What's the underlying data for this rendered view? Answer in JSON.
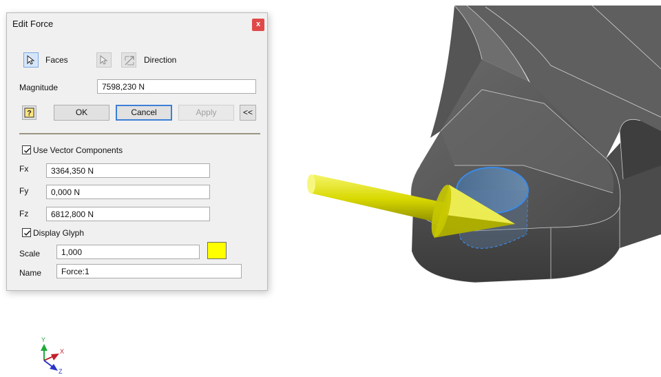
{
  "dialog": {
    "title": "Edit Force",
    "close_label": "x",
    "faces_label": "Faces",
    "direction_label": "Direction",
    "magnitude_label": "Magnitude",
    "magnitude_value": "7598,230 N",
    "help_label": "?",
    "ok_label": "OK",
    "cancel_label": "Cancel",
    "apply_label": "Apply",
    "collapse_label": "<<",
    "use_vector_components_label": "Use Vector Components",
    "use_vector_components_checked": true,
    "fx_label": "Fx",
    "fx_value": "3364,350 N",
    "fy_label": "Fy",
    "fy_value": "0,000 N",
    "fz_label": "Fz",
    "fz_value": "6812,800 N",
    "display_glyph_label": "Display Glyph",
    "display_glyph_checked": true,
    "scale_label": "Scale",
    "scale_value": "1,000",
    "glyph_color": "#ffff00",
    "name_label": "Name",
    "name_value": "Force:1"
  },
  "triad": {
    "x_label": "X",
    "y_label": "Y",
    "z_label": "Z",
    "x_color": "#c0202a",
    "y_color": "#1faa3a",
    "z_color": "#2a35c8"
  },
  "viewport": {
    "part_color": "#5d5d5d",
    "face_highlight_color": "#3a8be8",
    "force_arrow_color": "#e6e600"
  }
}
